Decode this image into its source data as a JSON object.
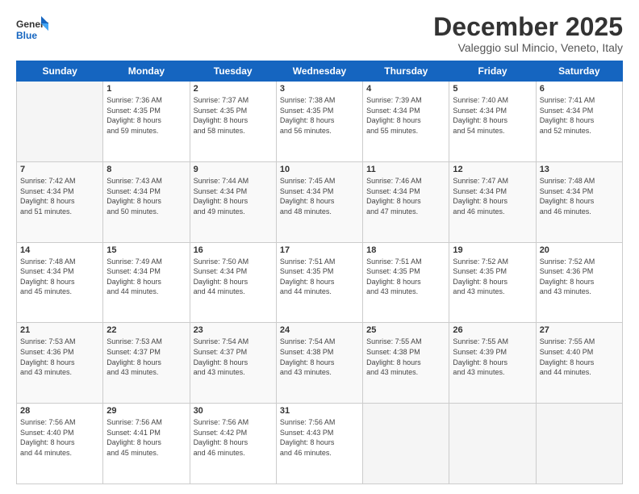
{
  "logo": {
    "line1": "General",
    "line2": "Blue"
  },
  "title": "December 2025",
  "location": "Valeggio sul Mincio, Veneto, Italy",
  "weekdays": [
    "Sunday",
    "Monday",
    "Tuesday",
    "Wednesday",
    "Thursday",
    "Friday",
    "Saturday"
  ],
  "weeks": [
    [
      {
        "day": "",
        "info": ""
      },
      {
        "day": "1",
        "info": "Sunrise: 7:36 AM\nSunset: 4:35 PM\nDaylight: 8 hours\nand 59 minutes."
      },
      {
        "day": "2",
        "info": "Sunrise: 7:37 AM\nSunset: 4:35 PM\nDaylight: 8 hours\nand 58 minutes."
      },
      {
        "day": "3",
        "info": "Sunrise: 7:38 AM\nSunset: 4:35 PM\nDaylight: 8 hours\nand 56 minutes."
      },
      {
        "day": "4",
        "info": "Sunrise: 7:39 AM\nSunset: 4:34 PM\nDaylight: 8 hours\nand 55 minutes."
      },
      {
        "day": "5",
        "info": "Sunrise: 7:40 AM\nSunset: 4:34 PM\nDaylight: 8 hours\nand 54 minutes."
      },
      {
        "day": "6",
        "info": "Sunrise: 7:41 AM\nSunset: 4:34 PM\nDaylight: 8 hours\nand 52 minutes."
      }
    ],
    [
      {
        "day": "7",
        "info": "Sunrise: 7:42 AM\nSunset: 4:34 PM\nDaylight: 8 hours\nand 51 minutes."
      },
      {
        "day": "8",
        "info": "Sunrise: 7:43 AM\nSunset: 4:34 PM\nDaylight: 8 hours\nand 50 minutes."
      },
      {
        "day": "9",
        "info": "Sunrise: 7:44 AM\nSunset: 4:34 PM\nDaylight: 8 hours\nand 49 minutes."
      },
      {
        "day": "10",
        "info": "Sunrise: 7:45 AM\nSunset: 4:34 PM\nDaylight: 8 hours\nand 48 minutes."
      },
      {
        "day": "11",
        "info": "Sunrise: 7:46 AM\nSunset: 4:34 PM\nDaylight: 8 hours\nand 47 minutes."
      },
      {
        "day": "12",
        "info": "Sunrise: 7:47 AM\nSunset: 4:34 PM\nDaylight: 8 hours\nand 46 minutes."
      },
      {
        "day": "13",
        "info": "Sunrise: 7:48 AM\nSunset: 4:34 PM\nDaylight: 8 hours\nand 46 minutes."
      }
    ],
    [
      {
        "day": "14",
        "info": "Sunrise: 7:48 AM\nSunset: 4:34 PM\nDaylight: 8 hours\nand 45 minutes."
      },
      {
        "day": "15",
        "info": "Sunrise: 7:49 AM\nSunset: 4:34 PM\nDaylight: 8 hours\nand 44 minutes."
      },
      {
        "day": "16",
        "info": "Sunrise: 7:50 AM\nSunset: 4:34 PM\nDaylight: 8 hours\nand 44 minutes."
      },
      {
        "day": "17",
        "info": "Sunrise: 7:51 AM\nSunset: 4:35 PM\nDaylight: 8 hours\nand 44 minutes."
      },
      {
        "day": "18",
        "info": "Sunrise: 7:51 AM\nSunset: 4:35 PM\nDaylight: 8 hours\nand 43 minutes."
      },
      {
        "day": "19",
        "info": "Sunrise: 7:52 AM\nSunset: 4:35 PM\nDaylight: 8 hours\nand 43 minutes."
      },
      {
        "day": "20",
        "info": "Sunrise: 7:52 AM\nSunset: 4:36 PM\nDaylight: 8 hours\nand 43 minutes."
      }
    ],
    [
      {
        "day": "21",
        "info": "Sunrise: 7:53 AM\nSunset: 4:36 PM\nDaylight: 8 hours\nand 43 minutes."
      },
      {
        "day": "22",
        "info": "Sunrise: 7:53 AM\nSunset: 4:37 PM\nDaylight: 8 hours\nand 43 minutes."
      },
      {
        "day": "23",
        "info": "Sunrise: 7:54 AM\nSunset: 4:37 PM\nDaylight: 8 hours\nand 43 minutes."
      },
      {
        "day": "24",
        "info": "Sunrise: 7:54 AM\nSunset: 4:38 PM\nDaylight: 8 hours\nand 43 minutes."
      },
      {
        "day": "25",
        "info": "Sunrise: 7:55 AM\nSunset: 4:38 PM\nDaylight: 8 hours\nand 43 minutes."
      },
      {
        "day": "26",
        "info": "Sunrise: 7:55 AM\nSunset: 4:39 PM\nDaylight: 8 hours\nand 43 minutes."
      },
      {
        "day": "27",
        "info": "Sunrise: 7:55 AM\nSunset: 4:40 PM\nDaylight: 8 hours\nand 44 minutes."
      }
    ],
    [
      {
        "day": "28",
        "info": "Sunrise: 7:56 AM\nSunset: 4:40 PM\nDaylight: 8 hours\nand 44 minutes."
      },
      {
        "day": "29",
        "info": "Sunrise: 7:56 AM\nSunset: 4:41 PM\nDaylight: 8 hours\nand 45 minutes."
      },
      {
        "day": "30",
        "info": "Sunrise: 7:56 AM\nSunset: 4:42 PM\nDaylight: 8 hours\nand 46 minutes."
      },
      {
        "day": "31",
        "info": "Sunrise: 7:56 AM\nSunset: 4:43 PM\nDaylight: 8 hours\nand 46 minutes."
      },
      {
        "day": "",
        "info": ""
      },
      {
        "day": "",
        "info": ""
      },
      {
        "day": "",
        "info": ""
      }
    ]
  ]
}
